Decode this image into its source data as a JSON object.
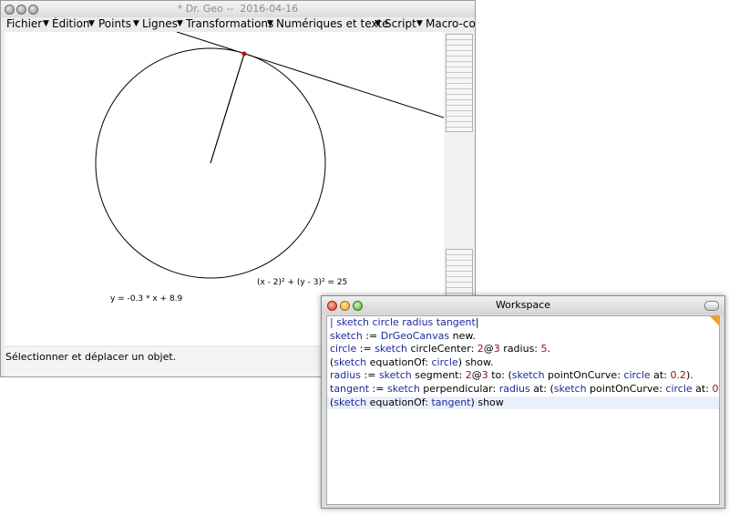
{
  "main_window": {
    "title": "* Dr. Geo --  2016-04-16",
    "menu": [
      {
        "label": "Fichier"
      },
      {
        "label": "Édition"
      },
      {
        "label": "Points"
      },
      {
        "label": "Lignes"
      },
      {
        "label": "Transformations"
      },
      {
        "label": "Numériques et texte"
      },
      {
        "label": "Script"
      },
      {
        "label": "Macro-cor"
      }
    ],
    "canvas": {
      "circle_equation": "(x  - 2)² + (y - 3)² = 25",
      "line_equation": "y = -0.3  * x + 8.9"
    },
    "status": "Sélectionner et déplacer un objet."
  },
  "workspace": {
    "title": "Workspace",
    "lines": [
      {
        "highlight": false,
        "tokens": [
          {
            "t": "| ",
            "c": "kw"
          },
          {
            "t": "sketch circle radius tangent",
            "c": "kw"
          },
          {
            "t": "|",
            "c": "txt"
          }
        ]
      },
      {
        "highlight": false,
        "tokens": [
          {
            "t": "sketch",
            "c": "kw"
          },
          {
            "t": " := ",
            "c": "txt"
          },
          {
            "t": "DrGeoCanvas",
            "c": "kw"
          },
          {
            "t": " new.",
            "c": "txt"
          }
        ]
      },
      {
        "highlight": false,
        "tokens": [
          {
            "t": "circle",
            "c": "kw"
          },
          {
            "t": " := ",
            "c": "txt"
          },
          {
            "t": "sketch",
            "c": "kw"
          },
          {
            "t": " circleCenter: ",
            "c": "txt"
          },
          {
            "t": "2",
            "c": "num"
          },
          {
            "t": "@",
            "c": "txt"
          },
          {
            "t": "3",
            "c": "num"
          },
          {
            "t": " radius: ",
            "c": "txt"
          },
          {
            "t": "5",
            "c": "num"
          },
          {
            "t": ".",
            "c": "txt"
          }
        ]
      },
      {
        "highlight": false,
        "tokens": [
          {
            "t": "(",
            "c": "txt"
          },
          {
            "t": "sketch",
            "c": "kw"
          },
          {
            "t": " equationOf: ",
            "c": "txt"
          },
          {
            "t": "circle",
            "c": "kw"
          },
          {
            "t": ") show.",
            "c": "txt"
          }
        ]
      },
      {
        "highlight": false,
        "tokens": [
          {
            "t": "radius",
            "c": "kw"
          },
          {
            "t": " := ",
            "c": "txt"
          },
          {
            "t": "sketch",
            "c": "kw"
          },
          {
            "t": " segment: ",
            "c": "txt"
          },
          {
            "t": "2",
            "c": "num"
          },
          {
            "t": "@",
            "c": "txt"
          },
          {
            "t": "3",
            "c": "num"
          },
          {
            "t": " to: (",
            "c": "txt"
          },
          {
            "t": "sketch",
            "c": "kw"
          },
          {
            "t": " pointOnCurve: ",
            "c": "txt"
          },
          {
            "t": "circle",
            "c": "kw"
          },
          {
            "t": " at: ",
            "c": "txt"
          },
          {
            "t": "0.2",
            "c": "num"
          },
          {
            "t": ").",
            "c": "txt"
          }
        ]
      },
      {
        "highlight": false,
        "tokens": [
          {
            "t": "tangent",
            "c": "kw"
          },
          {
            "t": " := ",
            "c": "txt"
          },
          {
            "t": "sketch",
            "c": "kw"
          },
          {
            "t": " perpendicular: ",
            "c": "txt"
          },
          {
            "t": "radius",
            "c": "kw"
          },
          {
            "t": " at: (",
            "c": "txt"
          },
          {
            "t": "sketch",
            "c": "kw"
          },
          {
            "t": " pointOnCurve: ",
            "c": "txt"
          },
          {
            "t": "circle",
            "c": "kw"
          },
          {
            "t": " at: ",
            "c": "txt"
          },
          {
            "t": "0.2",
            "c": "num"
          },
          {
            "t": ").",
            "c": "txt"
          }
        ]
      },
      {
        "highlight": true,
        "tokens": [
          {
            "t": "(",
            "c": "txt"
          },
          {
            "t": "sketch",
            "c": "kw"
          },
          {
            "t": " equationOf: ",
            "c": "txt"
          },
          {
            "t": "tangent",
            "c": "kw"
          },
          {
            "t": ") show",
            "c": "txt"
          }
        ]
      }
    ]
  },
  "colors": {
    "keyword": "#1d2a9a",
    "number": "#a01010",
    "point": "#cc0000",
    "line_highlight": "#eaf0fb"
  }
}
